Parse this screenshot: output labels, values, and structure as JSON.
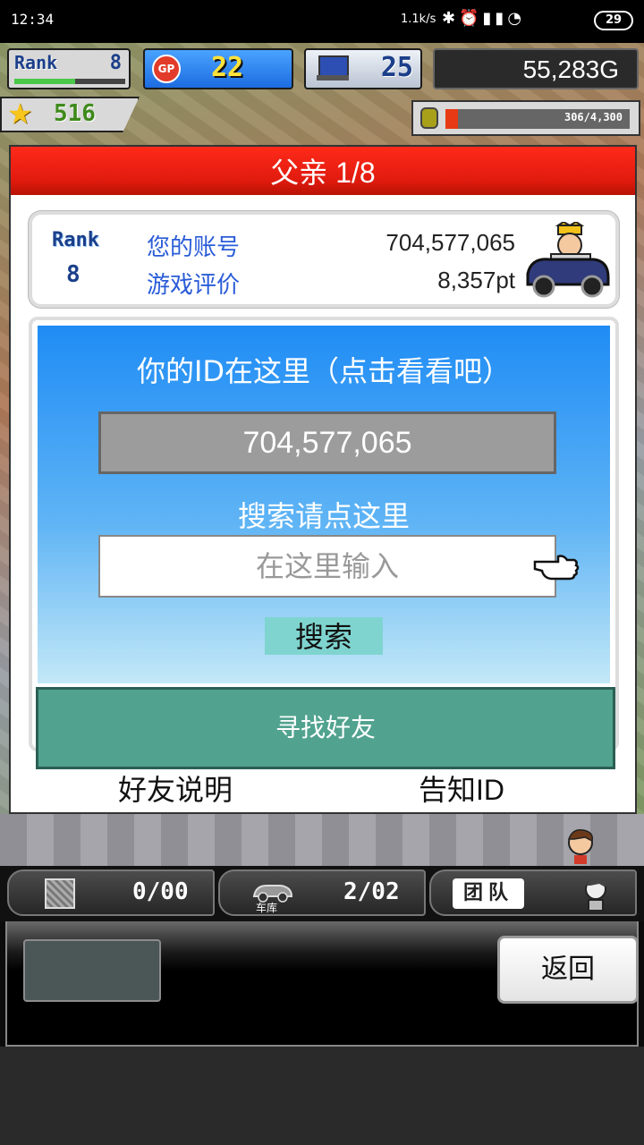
{
  "status_bar": {
    "time": "12:34",
    "speed": "1.1k/s",
    "icons": [
      "bluetooth-icon",
      "alarm-icon",
      "hd-signal-icon",
      "signal-icon",
      "wifi-icon"
    ],
    "battery": "29"
  },
  "hud": {
    "rank_label": "Rank",
    "rank_value": "8",
    "rank_progress": 0.55,
    "gp_label": "GP",
    "gp_value": "22",
    "pc_value": "25",
    "money": "55,283G",
    "stars": "516",
    "fuel": "306/4,300",
    "fuel_fraction": 0.07
  },
  "dialog": {
    "title": "父亲 1/8",
    "rank_label": "Rank",
    "rank_value": "8",
    "account_label": "您的账号",
    "account_value": "704,577,065",
    "rating_label": "游戏评价",
    "rating_value": "8,357pt",
    "id_heading": "你的ID在这里（点击看看吧）",
    "id_value": "704,577,065",
    "search_heading": "搜索请点这里",
    "search_placeholder": "在这里输入",
    "search_button": "搜索",
    "find_friends_button": "寻找好友",
    "friend_help_link": "好友说明",
    "share_id_link": "告知ID"
  },
  "toolbar": {
    "slot1_count": "0/00",
    "slot2_label": "车库",
    "slot2_count": "2/02",
    "team_label": "团队"
  },
  "bottom": {
    "back_button": "返回"
  },
  "colors": {
    "title_red": "#e01b0e",
    "panel_blue": "#1f8cf5",
    "find_button_green": "#51a38f",
    "search_button_teal": "#7fd4cf",
    "link_blue": "#2a5cd8"
  }
}
